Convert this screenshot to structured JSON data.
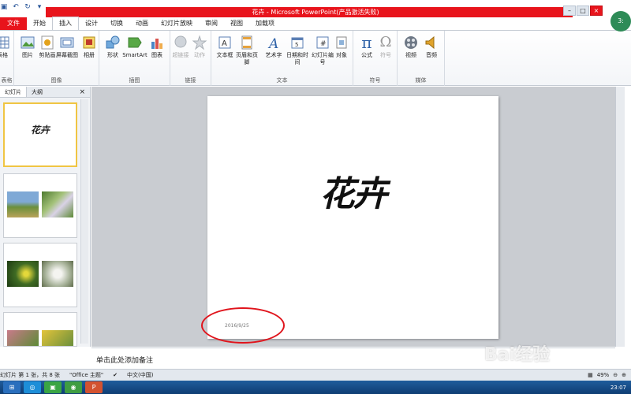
{
  "app": {
    "title": "花卉 - Microsoft PowerPoint(产品激活失败)",
    "avatar_text": "3:"
  },
  "tabs": [
    "文件",
    "开始",
    "插入",
    "设计",
    "切换",
    "动画",
    "幻灯片放映",
    "审阅",
    "视图",
    "加载项"
  ],
  "ribbon": {
    "groups": [
      {
        "label": "表格",
        "buttons": [
          "表格"
        ]
      },
      {
        "label": "图像",
        "buttons": [
          "图片",
          "剪贴画",
          "屏幕截图",
          "相册"
        ]
      },
      {
        "label": "插图",
        "buttons": [
          "形状",
          "SmartArt",
          "图表"
        ]
      },
      {
        "label": "链接",
        "buttons": [
          "超链接",
          "动作"
        ]
      },
      {
        "label": "文本",
        "buttons": [
          "文本框",
          "页眉和页脚",
          "艺术字",
          "日期和时间",
          "幻灯片编号",
          "对象"
        ]
      },
      {
        "label": "符号",
        "buttons": [
          "公式",
          "符号"
        ]
      },
      {
        "label": "媒体",
        "buttons": [
          "视频",
          "音频"
        ]
      }
    ]
  },
  "side_panel": {
    "tab_slides": "幻灯片",
    "tab_outline": "大纲",
    "close": "×",
    "thumb1_title": "花卉"
  },
  "slide": {
    "title": "花卉",
    "date": "2016/9/25"
  },
  "notes": {
    "placeholder": "单击此处添加备注"
  },
  "status": {
    "slide_info": "幻灯片 第 1 张，共 8 张",
    "theme": "\"Office 主题\"",
    "language": "中文(中国)",
    "zoom": "49%"
  },
  "taskbar": {
    "time": "23:07"
  },
  "watermark": "Bai经验"
}
